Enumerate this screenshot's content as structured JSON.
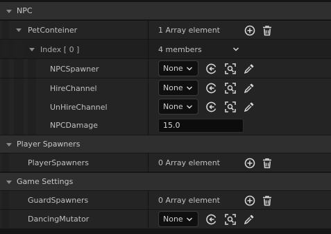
{
  "categories": {
    "npc": "NPC",
    "player_spawners": "Player Spawners",
    "game_settings": "Game Settings"
  },
  "pet_conteiner": {
    "label": "PetConteiner",
    "value": "1 Array element"
  },
  "index0": {
    "label": "Index [ 0 ]",
    "value": "4 members"
  },
  "npc_spawner": {
    "label": "NPCSpawner",
    "value": "None"
  },
  "hire_channel": {
    "label": "HireChannel",
    "value": "None"
  },
  "unhire_channel": {
    "label": "UnHireChannel",
    "value": "None"
  },
  "npc_damage": {
    "label": "NPCDamage",
    "value": "15.0"
  },
  "player_spawners": {
    "label": "PlayerSpawners",
    "value": "0 Array element"
  },
  "guard_spawners": {
    "label": "GuardSpawners",
    "value": "0 Array element"
  },
  "dancing_mutator": {
    "label": "DancingMutator",
    "value": "None"
  },
  "icons": [
    "add-icon",
    "delete-icon",
    "reset-to-default-icon",
    "browse-icon",
    "eyedropper-icon",
    "chevron-down-icon",
    "expand-arrow-icon"
  ],
  "colors": {
    "background": "#151515",
    "category_row": "#2f2f2f",
    "property_row": "#242424",
    "text": "#c0c0c0",
    "icon": "#d6d6d6"
  }
}
